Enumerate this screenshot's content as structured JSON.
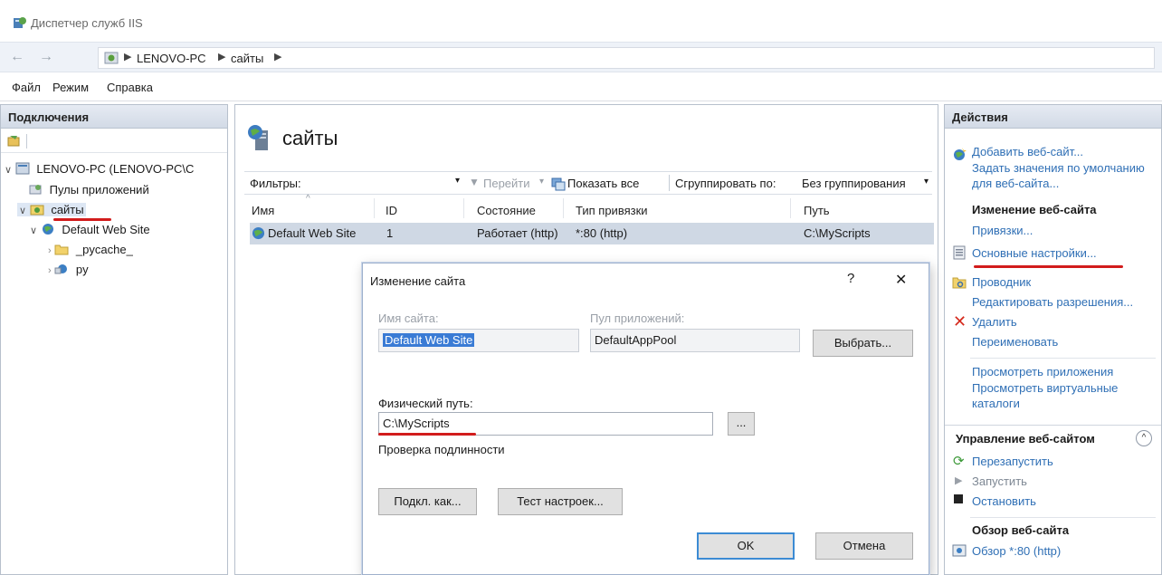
{
  "window": {
    "title": "Диспетчер служб IIS"
  },
  "address": {
    "crumbs": [
      "LENOVO-PC",
      "сайты"
    ]
  },
  "menu": {
    "items": [
      "Файл",
      "Режим",
      "Справка"
    ]
  },
  "connections": {
    "title": "Подключения",
    "tree": [
      {
        "label": "LENOVO-PC (LENOVO-PC\\C",
        "level": 0
      },
      {
        "label": "Пулы приложений",
        "level": 1
      },
      {
        "label": "сайты",
        "level": 1
      },
      {
        "label": "Default Web Site",
        "level": 2
      },
      {
        "label": "_pycache_",
        "level": 3
      },
      {
        "label": "py",
        "level": 3
      }
    ]
  },
  "center": {
    "title": "сайты",
    "filter_label": "Фильтры:",
    "go_label": "Перейти",
    "show_all_label": "Показать все",
    "group_by_label": "Сгруппировать по:",
    "group_by_value": "Без группирования",
    "columns": [
      "Имя",
      "ID",
      "Состояние",
      "Тип привязки",
      "Путь"
    ],
    "rows": [
      [
        "Default Web Site",
        "1",
        "Работает (http)",
        "*:80 (http)",
        "C:\\MyScripts"
      ]
    ]
  },
  "dialog": {
    "title": "Изменение сайта",
    "help": "?",
    "close": "✕",
    "site_name_label": "Имя сайта:",
    "site_name_value": "Default Web Site",
    "pool_label": "Пул приложений:",
    "pool_value": "DefaultAppPool",
    "select_button": "Выбрать...",
    "path_label": "Физический путь:",
    "path_value": "C:\\MyScripts",
    "browse_button": "...",
    "auth_label": "Проверка подлинности",
    "connect_as_button": "Подкл. как...",
    "test_button": "Тест настроек...",
    "ok_button": "OK",
    "cancel_button": "Отмена"
  },
  "actions": {
    "title": "Действия",
    "add_site": "Добавить веб-сайт...",
    "defaults": "Задать значения по умолчанию для веб-сайта...",
    "edit_site_head": "Изменение веб-сайта",
    "bindings": "Привязки...",
    "basic_settings": "Основные настройки...",
    "explorer": "Проводник",
    "edit_permissions": "Редактировать разрешения...",
    "delete": "Удалить",
    "rename": "Переименовать",
    "view_apps": "Просмотреть приложения",
    "view_vdirs": "Просмотреть виртуальные каталоги",
    "manage_head": "Управление веб-сайтом",
    "restart": "Перезапустить",
    "start": "Запустить",
    "stop": "Остановить",
    "browse_head": "Обзор веб-сайта",
    "browse_80": "Обзор *:80 (http)"
  },
  "colors": {
    "accent": "#2f6fb5",
    "annotation": "#d21c1c",
    "selection": "#3a7bd5"
  }
}
